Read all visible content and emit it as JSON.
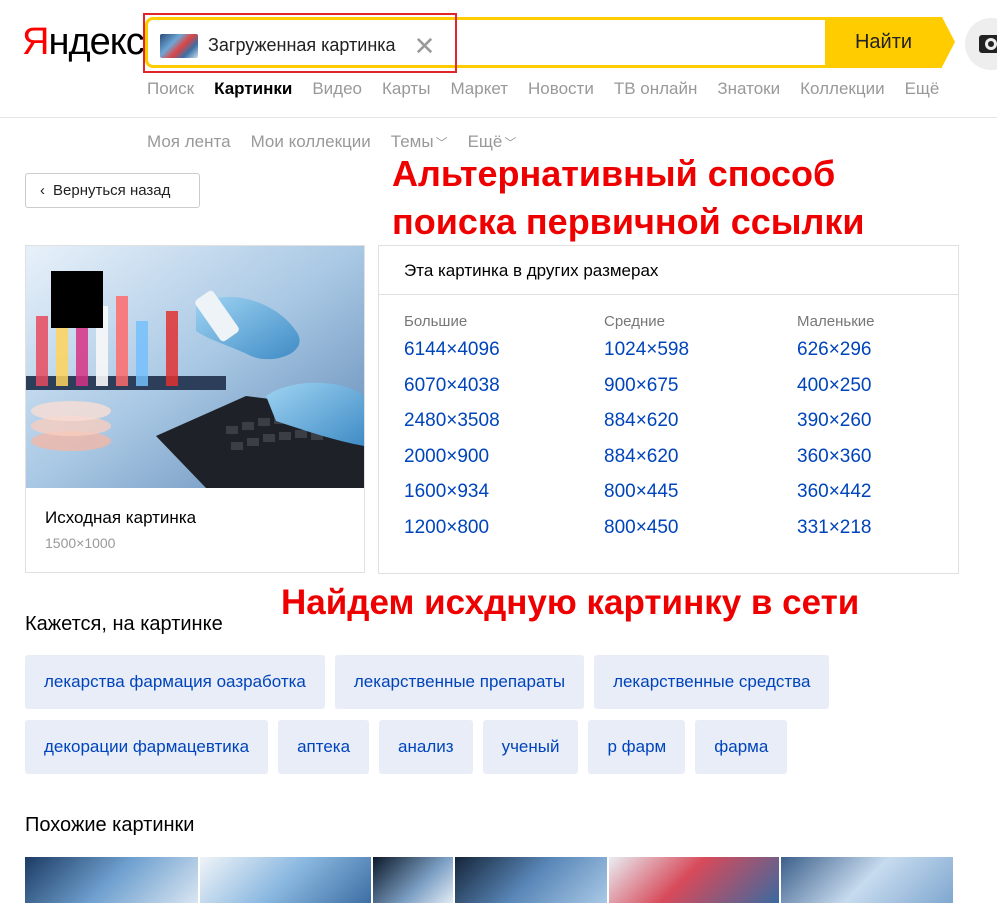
{
  "logo": {
    "first": "Я",
    "rest": "ндекс"
  },
  "search": {
    "chip_label": "Загруженная картинка",
    "button_label": "Найти"
  },
  "nav": [
    "Поиск",
    "Картинки",
    "Видео",
    "Карты",
    "Маркет",
    "Новости",
    "ТВ онлайн",
    "Знатоки",
    "Коллекции",
    "Ещё"
  ],
  "nav_active": "Картинки",
  "subnav": {
    "feed": "Моя лента",
    "collections": "Мои коллекции",
    "themes": "Темы",
    "more": "Ещё"
  },
  "back_button": "Вернуться назад",
  "annotations": {
    "top": "Альтернативный способ поиска первичной ссылки",
    "bottom": "Найдем исхдную картинку в сети"
  },
  "original": {
    "title": "Исходная картинка",
    "size": "1500×1000"
  },
  "sizes_panel": {
    "title": "Эта картинка в других размерах",
    "columns": [
      {
        "heading": "Большие",
        "items": [
          "6144×4096",
          "6070×4038",
          "2480×3508",
          "2000×900",
          "1600×934",
          "1200×800"
        ]
      },
      {
        "heading": "Средние",
        "items": [
          "1024×598",
          "900×675",
          "884×620",
          "884×620",
          "800×445",
          "800×450"
        ]
      },
      {
        "heading": "Маленькие",
        "items": [
          "626×296",
          "400×250",
          "390×260",
          "360×360",
          "360×442",
          "331×218"
        ]
      }
    ]
  },
  "tags_section": {
    "title": "Кажется, на картинке",
    "rows": [
      [
        "лекарства фармация оазработка",
        "лекарственные препараты",
        "лекарственные средства"
      ],
      [
        "декорации фармацевтика",
        "аптека",
        "анализ",
        "ученый",
        "р фарм",
        "фарма"
      ]
    ]
  },
  "similar_section": {
    "title": "Похожие картинки"
  },
  "colors": {
    "accent": "#ffcc00",
    "link": "#0044bb",
    "annotation": "#ee0000",
    "tag_bg": "#e8edf7"
  }
}
